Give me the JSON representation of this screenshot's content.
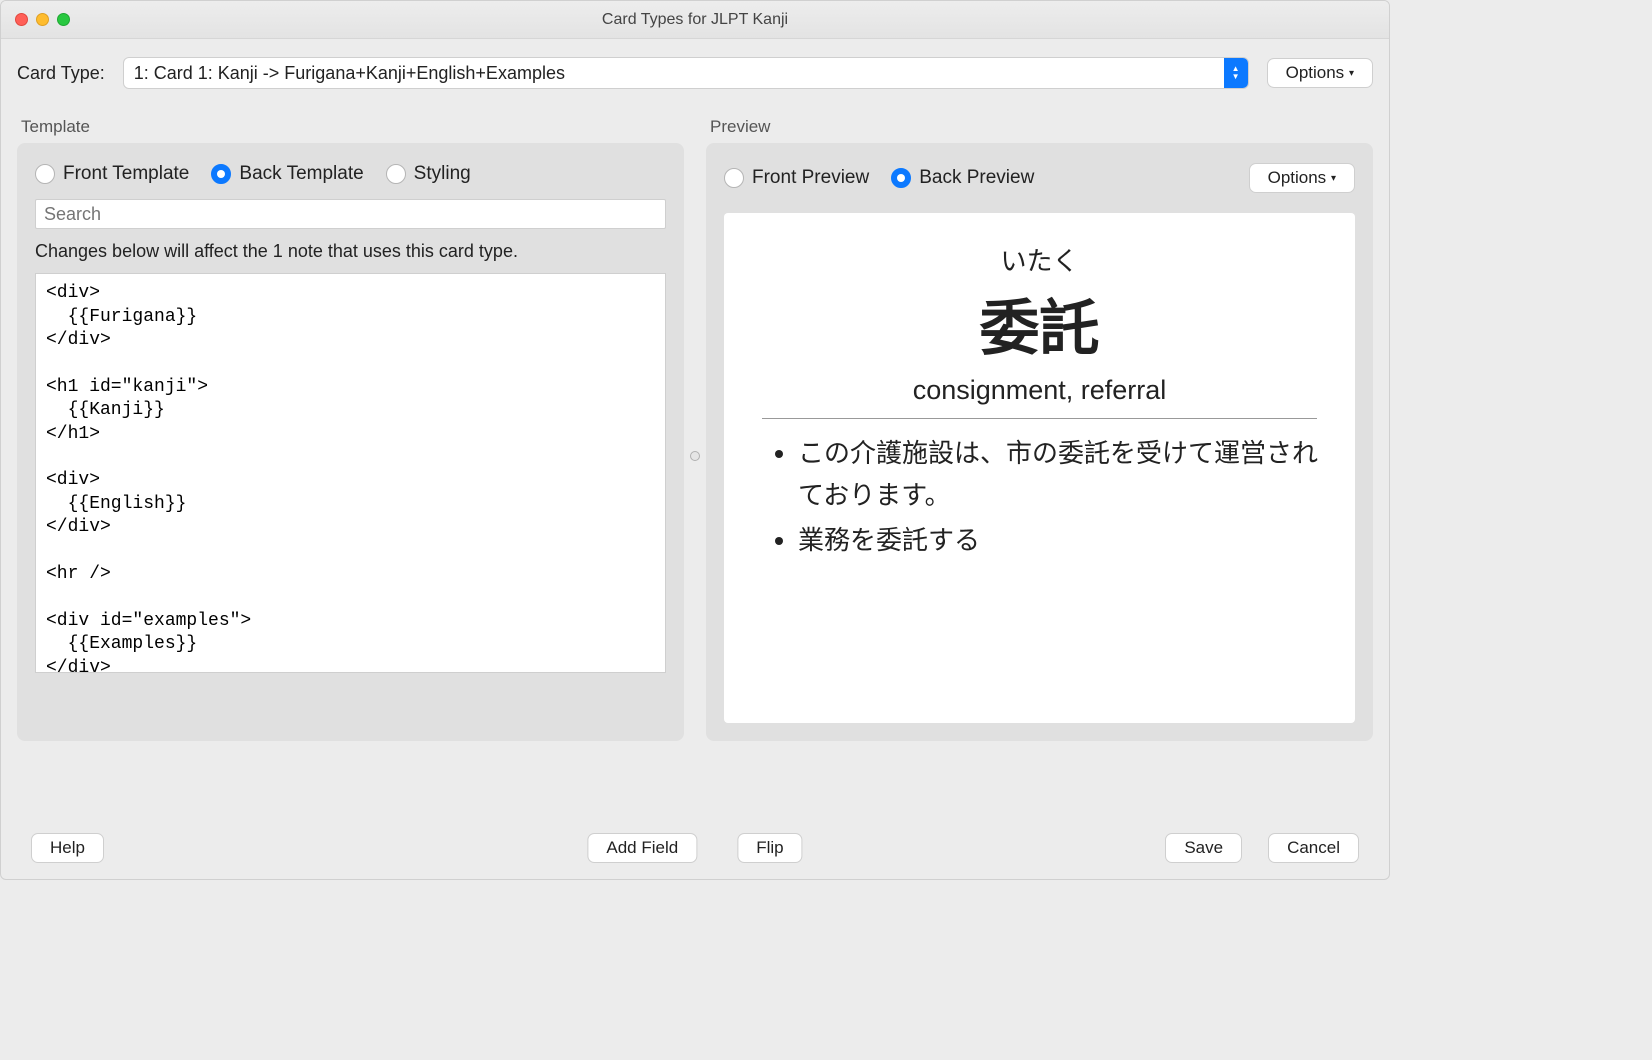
{
  "window": {
    "title": "Card Types for JLPT Kanji"
  },
  "top": {
    "label": "Card Type:",
    "selected": "1: Card 1: Kanji -> Furigana+Kanji+English+Examples",
    "options_button": "Options"
  },
  "template": {
    "section_label": "Template",
    "radios": {
      "front": "Front Template",
      "back": "Back Template",
      "styling": "Styling"
    },
    "search_placeholder": "Search",
    "hint": "Changes below will affect the 1 note that uses this card type.",
    "code": "<div>\n  {{Furigana}}\n</div>\n\n<h1 id=\"kanji\">\n  {{Kanji}}\n</h1>\n\n<div>\n  {{English}}\n</div>\n\n<hr />\n\n<div id=\"examples\">\n  {{Examples}}\n</div>"
  },
  "preview": {
    "section_label": "Preview",
    "radios": {
      "front": "Front Preview",
      "back": "Back Preview"
    },
    "options_button": "Options",
    "card": {
      "furigana": "いたく",
      "kanji": "委託",
      "english": "consignment, referral",
      "examples": [
        "この介護施設は、市の委託を受けて運営されております。",
        "業務を委託する"
      ]
    }
  },
  "footer": {
    "help": "Help",
    "add_field": "Add Field",
    "flip": "Flip",
    "save": "Save",
    "cancel": "Cancel"
  }
}
